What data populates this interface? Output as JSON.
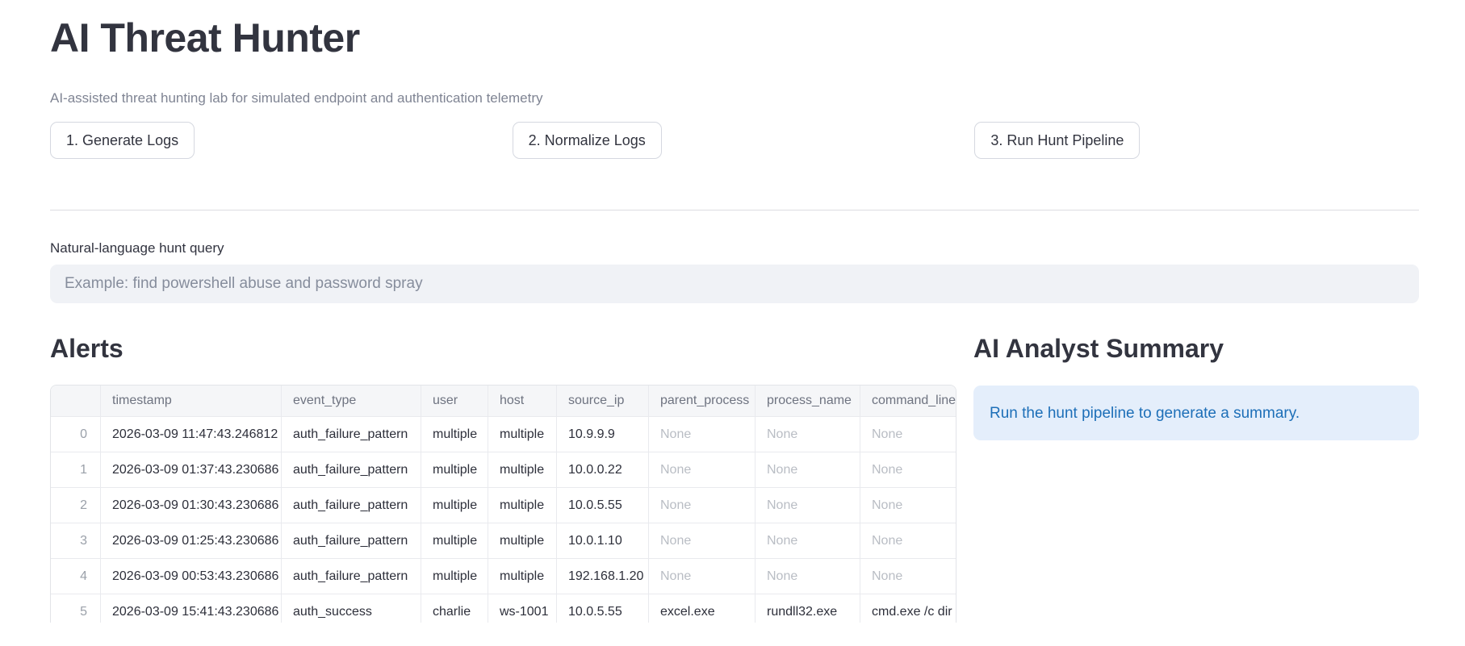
{
  "page": {
    "title": "AI Threat Hunter",
    "subtitle": "AI-assisted threat hunting lab for simulated endpoint and authentication telemetry"
  },
  "buttons": [
    {
      "label": "1. Generate Logs"
    },
    {
      "label": "2. Normalize Logs"
    },
    {
      "label": "3. Run Hunt Pipeline"
    }
  ],
  "query": {
    "label": "Natural-language hunt query",
    "value": "",
    "placeholder": "Example: find powershell abuse and password spray"
  },
  "alerts": {
    "heading": "Alerts",
    "table": {
      "columns": [
        "",
        "timestamp",
        "event_type",
        "user",
        "host",
        "source_ip",
        "parent_process",
        "process_name",
        "command_line"
      ],
      "rows": [
        [
          "0",
          "2026-03-09 11:47:43.246812",
          "auth_failure_pattern",
          "multiple",
          "multiple",
          "10.9.9.9",
          "None",
          "None",
          "None"
        ],
        [
          "1",
          "2026-03-09 01:37:43.230686",
          "auth_failure_pattern",
          "multiple",
          "multiple",
          "10.0.0.22",
          "None",
          "None",
          "None"
        ],
        [
          "2",
          "2026-03-09 01:30:43.230686",
          "auth_failure_pattern",
          "multiple",
          "multiple",
          "10.0.5.55",
          "None",
          "None",
          "None"
        ],
        [
          "3",
          "2026-03-09 01:25:43.230686",
          "auth_failure_pattern",
          "multiple",
          "multiple",
          "10.0.1.10",
          "None",
          "None",
          "None"
        ],
        [
          "4",
          "2026-03-09 00:53:43.230686",
          "auth_failure_pattern",
          "multiple",
          "multiple",
          "192.168.1.20",
          "None",
          "None",
          "None"
        ],
        [
          "5",
          "2026-03-09 15:41:43.230686",
          "auth_success",
          "charlie",
          "ws-1001",
          "10.0.5.55",
          "excel.exe",
          "rundll32.exe",
          "cmd.exe /c dir"
        ]
      ]
    }
  },
  "summary": {
    "heading": "AI Analyst Summary",
    "info_message": "Run the hunt pipeline to generate a summary."
  },
  "colors": {
    "text_primary": "#32343f",
    "text_muted": "#7f8493",
    "input_bg": "#f0f2f6",
    "info_bg": "#e4eefb",
    "info_text": "#1d6fb8",
    "none_value_text": "#b9bdc4"
  }
}
